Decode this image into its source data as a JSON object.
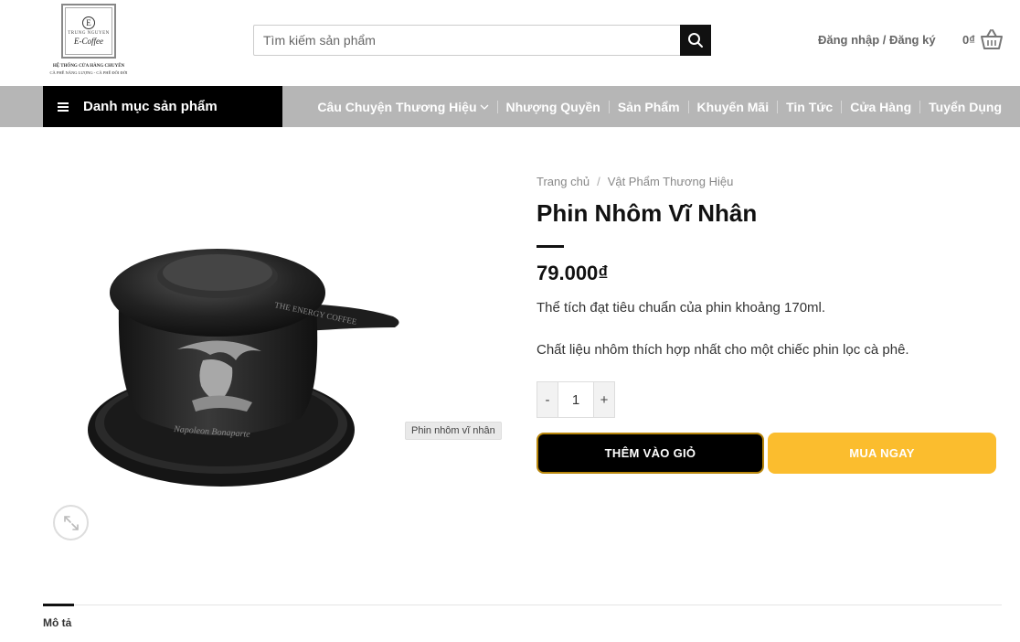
{
  "header": {
    "logo": {
      "letter": "E",
      "brand": "TRUNG NGUYEN",
      "script": "E-Coffee",
      "line1": "HỆ THỐNG CỬA HÀNG CHUYÊN",
      "line2": "CÀ PHÊ NĂNG LƯỢNG - CÀ PHÊ ĐỔI ĐỜI"
    },
    "search_placeholder": "Tìm kiếm sản phẩm",
    "login_label": "Đăng nhập / Đăng ký",
    "cart_amount": "0₫"
  },
  "nav": {
    "category_label": "Danh mục sản phẩm",
    "items": [
      {
        "label": "Câu Chuyện Thương Hiệu",
        "dropdown": true
      },
      {
        "label": "Nhượng Quyền"
      },
      {
        "label": "Sản Phẩm"
      },
      {
        "label": "Khuyến Mãi"
      },
      {
        "label": "Tin Tức"
      },
      {
        "label": "Cửa Hàng"
      },
      {
        "label": "Tuyển Dụng"
      }
    ]
  },
  "product": {
    "image_caption": "Phin nhôm vĩ nhân",
    "image_engraving": "Napoleon Bonaparte",
    "image_rim_text": "THE ENERGY COFFEE",
    "breadcrumb": [
      "Trang chủ",
      "Vật Phẩm Thương Hiệu"
    ],
    "title": "Phin Nhôm Vĩ Nhân",
    "price": "79.000₫",
    "desc1": "Thể tích đạt tiêu chuẩn của phin khoảng 170ml.",
    "desc2": "Chất liệu nhôm thích hợp nhất cho một chiếc phin lọc cà phê.",
    "quantity": "1",
    "minus_label": "-",
    "plus_label": "+",
    "add_to_cart": "THÊM VÀO GIỎ",
    "buy_now": "MUA NGAY"
  },
  "tabs": {
    "active_label": "Mô tả"
  },
  "colors": {
    "nav_bg": "#b6b6b6",
    "buy_button": "#fbbd2e",
    "cart_button": "#000000"
  }
}
